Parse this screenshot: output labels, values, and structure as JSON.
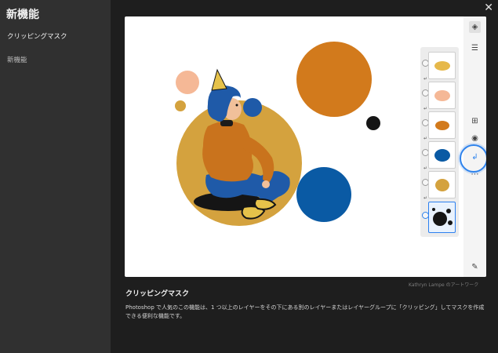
{
  "sidebar": {
    "title": "新機能",
    "items": [
      {
        "label": "クリッピングマスク"
      },
      {
        "label": "新機能"
      }
    ]
  },
  "dialog": {
    "close_icon": "close-icon"
  },
  "artwork": {
    "credit": "Kathryn Lampe のアートワーク"
  },
  "section": {
    "heading": "クリッピングマスク",
    "description": "Photoshop で人気のこの機能は、1 つ以上のレイヤーをその下にある別のレイヤーまたはレイヤーグループに「クリッピング」してマスクを作成できる便利な機能です。"
  },
  "layers_panel": {
    "count": 6,
    "selected_index": 5
  },
  "toolbar": {
    "icons": [
      "layers-icon",
      "adjustments-icon",
      "add-layer-icon",
      "visibility-icon",
      "clip-mask-icon",
      "more-icon",
      "brush-icon"
    ]
  },
  "colors": {
    "orange": "#d27a1c",
    "peach": "#f5b896",
    "mustard": "#d4a23e",
    "blue": "#0a5aa4",
    "accent": "#2d82ec",
    "sidebar_bg": "#303030",
    "page_bg": "#1e1e1e"
  }
}
